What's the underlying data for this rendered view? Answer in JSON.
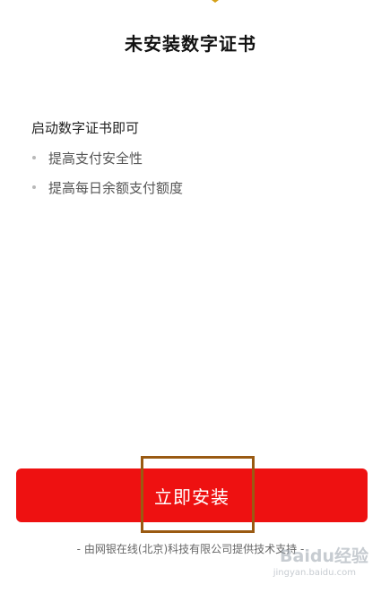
{
  "page": {
    "title": "未安装数字证书"
  },
  "info": {
    "heading": "启动数字证书即可",
    "benefits": [
      "提高支付安全性",
      "提高每日余额支付额度"
    ]
  },
  "install_button": {
    "label": "立即安装"
  },
  "footer": {
    "support_text": "- 由网银在线(北京)科技有限公司提供技术支持 -"
  },
  "watermark": {
    "brand": "Baidu经验",
    "site": "jingyan.baidu.com"
  },
  "colors": {
    "primary_button": "#ee1111",
    "annotation_box": "#9a5a12",
    "top_icon": "#d4a017"
  },
  "icons": {
    "top_icon": "gold-icon"
  }
}
